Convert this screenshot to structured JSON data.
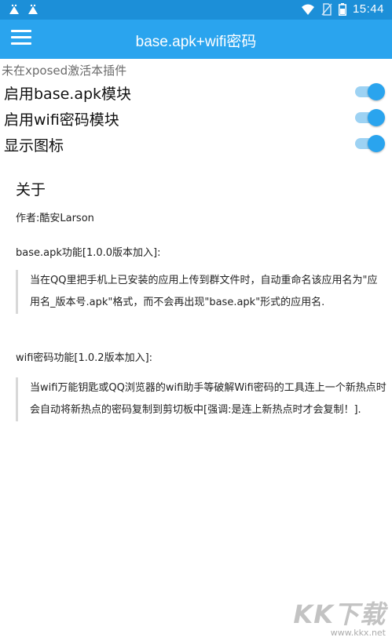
{
  "status_bar": {
    "time": "15:44"
  },
  "app_bar": {
    "title": "base.apk+wifi密码"
  },
  "notice": "未在xposed激活本插件",
  "toggles": [
    {
      "label": "启用base.apk模块",
      "on": true
    },
    {
      "label": "启用wifi密码模块",
      "on": true
    },
    {
      "label": "显示图标",
      "on": true
    }
  ],
  "about": {
    "title": "关于",
    "author": "作者:酷安Larson",
    "feature1_title": "base.apk功能[1.0.0版本加入]:",
    "feature1_desc": "当在QQ里把手机上已安装的应用上传到群文件时，自动重命名该应用名为\"应用名_版本号.apk\"格式，而不会再出现\"base.apk\"形式的应用名.",
    "feature2_title": "wifi密码功能[1.0.2版本加入]:",
    "feature2_desc": "当wifi万能钥匙或QQ浏览器的wifi助手等破解Wifi密码的工具连上一个新热点时会自动将新热点的密码复制到剪切板中[强调:是连上新热点时才会复制！]."
  },
  "watermark": {
    "main": "KK下载",
    "url": "www.kkx.net"
  },
  "colors": {
    "status_bar": "#1c8fd8",
    "app_bar": "#2aa4ee",
    "toggle_thumb": "#2aa4ee",
    "toggle_track": "#9dd2f3"
  }
}
